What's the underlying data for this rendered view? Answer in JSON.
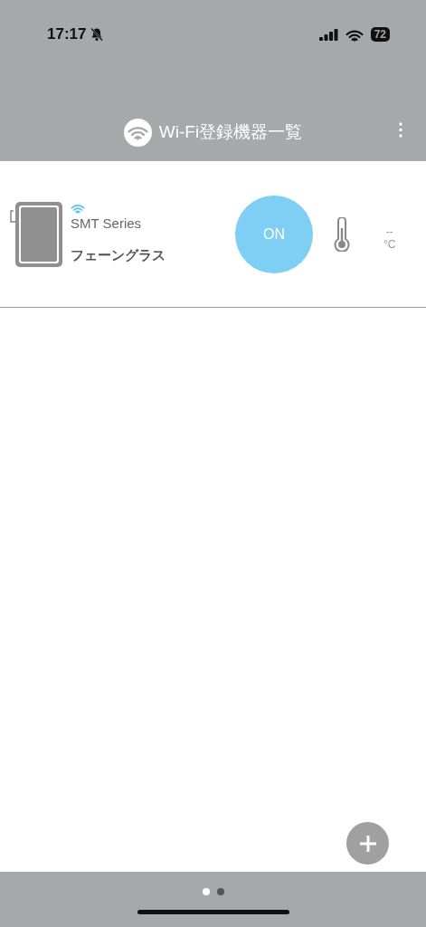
{
  "status_bar": {
    "time": "17:17",
    "battery": "72"
  },
  "header": {
    "title": "Wi-Fi登録機器一覧"
  },
  "devices": [
    {
      "model": "SMT Series",
      "name": "フェーングラス",
      "connected": true,
      "power": "ON",
      "power_on": true,
      "temperature": "--",
      "unit": "°C"
    }
  ],
  "pager": [
    {
      "selected": true
    },
    {
      "selected": false
    }
  ]
}
